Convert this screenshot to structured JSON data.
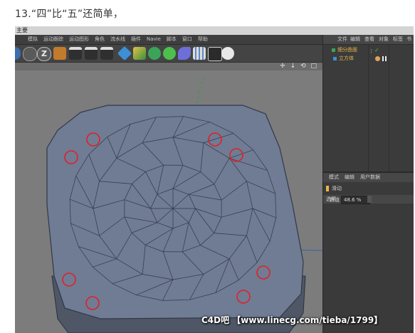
{
  "caption": "13.“四”比“五”还简单，",
  "window": {
    "title": "主要"
  },
  "menu": [
    "模拟",
    "运动跟踪",
    "运动图形",
    "角色",
    "流水线",
    "插件",
    "Navie",
    "脚本",
    "窗口",
    "帮助"
  ],
  "toolbar_icons": [
    "x-axis-icon",
    "y-axis-icon",
    "z-axis-icon",
    "world-coords-icon",
    "render-view-icon",
    "render-picture-icon",
    "render-settings-icon",
    "cube-icon",
    "pen-icon",
    "subdivision-icon",
    "array-icon",
    "deformer-icon",
    "floor-icon",
    "camera-icon",
    "light-icon"
  ],
  "viewport": {
    "nav_icons": "✛ ↓ ⟲ □"
  },
  "object_manager": {
    "tabs": [
      "文件",
      "编辑",
      "查看",
      "对象",
      "标签",
      "书签"
    ],
    "objects": [
      {
        "name": "细分曲面",
        "color": "#e8b54a"
      },
      {
        "name": "立方体",
        "color": "#e8b54a"
      }
    ]
  },
  "attribute_manager": {
    "tabs": [
      "模式",
      "编辑",
      "用户数据"
    ],
    "tool_name": "滑动",
    "section": "选项",
    "field_label": "数值",
    "field_value": "48.6 %"
  },
  "colors": {
    "mesh_fill": "#6f7c93",
    "mesh_edge": "#31384a",
    "highlight_circle": "#e0202a",
    "viewport_bg": "#7c7c7c"
  },
  "watermark": "C4D吧 【www.linecg.com/tieba/1799】"
}
